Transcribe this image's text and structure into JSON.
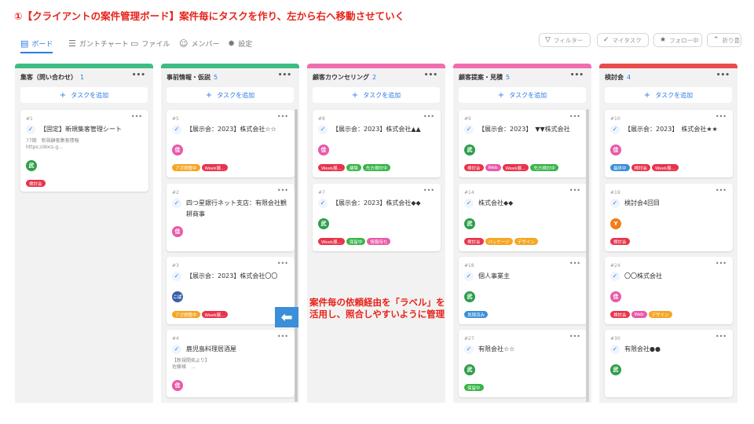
{
  "banner": "①【クライアントの案件管理ボード】案件毎にタスクを作り、左から右へ移動させていく",
  "toolbar": {
    "tabs": [
      {
        "icon": "board-icon",
        "glyph": "▤",
        "label": "ボード"
      },
      {
        "icon": "gantt-icon",
        "glyph": "☰",
        "label": "ガントチャート"
      },
      {
        "icon": "file-icon",
        "glyph": "▭",
        "label": "ファイル"
      },
      {
        "icon": "member-icon",
        "glyph": "☺",
        "label": "メンバー"
      },
      {
        "icon": "settings-icon",
        "glyph": "✹",
        "label": "設定"
      }
    ],
    "filters": [
      {
        "glyph": "▽",
        "label": "フィルター"
      },
      {
        "glyph": "✓",
        "label": "マイタスク"
      },
      {
        "glyph": "★",
        "label": "フォロー中"
      },
      {
        "glyph": "⌃",
        "label": "折り畳"
      }
    ]
  },
  "add_task_label": "タスクを追加",
  "colors": {
    "accent": "#2d7be5",
    "col_green": "#3dbd83",
    "col_pink": "#f06eb0",
    "col_red": "#e84b4b",
    "label_red": "#e8334a",
    "label_orange": "#f5a623",
    "label_green": "#39b54a",
    "label_blue": "#3b8fd9",
    "label_pink": "#e85aa8",
    "label_magenta": "#d63a98",
    "avatar_pink": "#e85aa8",
    "avatar_green": "#2e9e4a",
    "avatar_navy": "#3a5fa8",
    "avatar_orange": "#f07f1a"
  },
  "columns": [
    {
      "name": "集客（問い合わせ）",
      "count": "1",
      "bar": "#3dbd83",
      "cards": [
        {
          "num": "#1",
          "title": "【固定】新規集客管理シート",
          "desc": [
            "77期　新規顧客集客情報",
            "https://docs.g..."
          ],
          "avatar": "武",
          "avatar_color": "#2e9e4a",
          "labels": [
            {
              "text": "検討会",
              "color": "#e8334a"
            }
          ]
        }
      ]
    },
    {
      "name": "事前情報・仮説",
      "count": "5",
      "bar": "#3dbd83",
      "cards": [
        {
          "num": "#5",
          "title": "【展示会：2023】株式会社☆☆",
          "desc": [],
          "avatar": "佳",
          "avatar_color": "#e85aa8",
          "labels": [
            {
              "text": "アポ調整中",
              "color": "#f5a623"
            },
            {
              "text": "Week展...",
              "color": "#e8334a"
            }
          ]
        },
        {
          "num": "#2",
          "title": "四つ星銀行ネット支店：有限会社観耕商事",
          "desc": [],
          "avatar": "佳",
          "avatar_color": "#e85aa8",
          "labels": []
        },
        {
          "num": "#3",
          "title": "【展示会：2023】株式会社〇〇",
          "desc": [],
          "avatar": "こば",
          "avatar_color": "#3a5fa8",
          "labels": [
            {
              "text": "アポ調整中",
              "color": "#f5a623"
            },
            {
              "text": "Week展...",
              "color": "#e8334a"
            }
          ]
        },
        {
          "num": "#4",
          "title": "鹿児島料理居酒屋",
          "desc": [
            "【新規開拓より】",
            "佐藤様　..."
          ],
          "avatar": "佳",
          "avatar_color": "#e85aa8",
          "labels": []
        }
      ]
    },
    {
      "name": "顧客カウンセリング",
      "count": "2",
      "bar": "#f06eb0",
      "cards": [
        {
          "num": "#8",
          "title": "【展示会：2023】株式会社▲▲",
          "desc": [],
          "avatar": "佳",
          "avatar_color": "#e85aa8",
          "labels": [
            {
              "text": "Week展...",
              "color": "#e8334a"
            },
            {
              "text": "建築",
              "color": "#39b54a"
            },
            {
              "text": "先方検討中",
              "color": "#39b54a"
            }
          ]
        },
        {
          "num": "#7",
          "title": "【展示会：2023】株式会社◆◆",
          "desc": [],
          "avatar": "武",
          "avatar_color": "#2e9e4a",
          "labels": [
            {
              "text": "Week展...",
              "color": "#e8334a"
            },
            {
              "text": "保留中",
              "color": "#39b54a"
            },
            {
              "text": "情報待ち",
              "color": "#e85aa8"
            }
          ]
        }
      ]
    },
    {
      "name": "顧客提案・見積",
      "count": "5",
      "bar": "#f06eb0",
      "cards": [
        {
          "num": "#9",
          "title": "【展示会：2023】　▼▼株式会社",
          "desc": [],
          "avatar": "武",
          "avatar_color": "#2e9e4a",
          "labels": [
            {
              "text": "検討会",
              "color": "#e8334a"
            },
            {
              "text": "Web",
              "color": "#e85aa8"
            },
            {
              "text": "Week展...",
              "color": "#e8334a"
            },
            {
              "text": "先方検討中",
              "color": "#39b54a"
            }
          ]
        },
        {
          "num": "#14",
          "title": "株式会社◆◆",
          "desc": [],
          "avatar": "武",
          "avatar_color": "#2e9e4a",
          "labels": [
            {
              "text": "検討会",
              "color": "#e8334a"
            },
            {
              "text": "パッケージ",
              "color": "#f5a623"
            },
            {
              "text": "デザイン",
              "color": "#f5a623"
            }
          ]
        },
        {
          "num": "#18",
          "title": "個人事業主",
          "desc": [],
          "avatar": "武",
          "avatar_color": "#2e9e4a",
          "labels": [
            {
              "text": "見積済み",
              "color": "#3b8fd9"
            }
          ]
        },
        {
          "num": "#27",
          "title": "有限会社☆☆",
          "desc": [],
          "avatar": "武",
          "avatar_color": "#2e9e4a",
          "labels": [
            {
              "text": "保留中",
              "color": "#39b54a"
            }
          ]
        }
      ]
    },
    {
      "name": "検討会",
      "count": "4",
      "bar": "#e84b4b",
      "cards": [
        {
          "num": "#10",
          "title": "【展示会：2023】　株式会社★★",
          "desc": [],
          "avatar": "佳",
          "avatar_color": "#e85aa8",
          "labels": [
            {
              "text": "最終中",
              "color": "#3b8fd9"
            },
            {
              "text": "検討会",
              "color": "#e8334a"
            },
            {
              "text": "Week展...",
              "color": "#e8334a"
            }
          ]
        },
        {
          "num": "#19",
          "title": "検討会4回目",
          "desc": [],
          "avatar": "Y",
          "avatar_color": "#f07f1a",
          "labels": [
            {
              "text": "検討会",
              "color": "#e8334a"
            }
          ]
        },
        {
          "num": "#24",
          "title": "〇〇株式会社",
          "desc": [],
          "avatar": "佳",
          "avatar_color": "#e85aa8",
          "labels": [
            {
              "text": "検討会",
              "color": "#e8334a"
            },
            {
              "text": "Web",
              "color": "#e85aa8"
            },
            {
              "text": "デザイン",
              "color": "#f5a623"
            }
          ]
        },
        {
          "num": "#30",
          "title": "有限会社●●",
          "desc": [],
          "avatar": "武",
          "avatar_color": "#2e9e4a",
          "labels": []
        }
      ]
    }
  ],
  "note": "案件毎の依頼経由を「ラベル」を活用し、照合しやすいように管理"
}
